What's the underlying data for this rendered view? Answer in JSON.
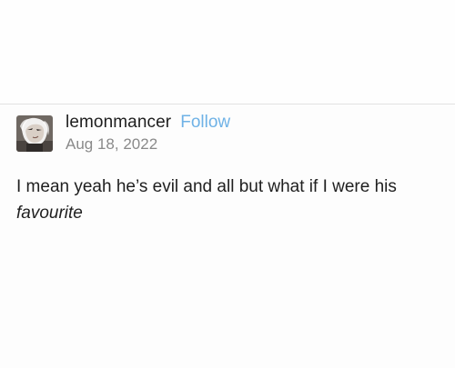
{
  "post": {
    "author": {
      "username": "lemonmancer",
      "follow_label": "Follow",
      "avatar_icon": "avatar-image"
    },
    "date": "Aug 18, 2022",
    "body": {
      "line_text": "I mean yeah he’s evil and all but what if I were his",
      "emphasis": "favourite"
    }
  },
  "colors": {
    "follow_link": "#6fb2e6",
    "username": "#1e1e1e",
    "date": "#8a8a8a",
    "body": "#1f1f1f",
    "divider": "#e2e2e2"
  }
}
